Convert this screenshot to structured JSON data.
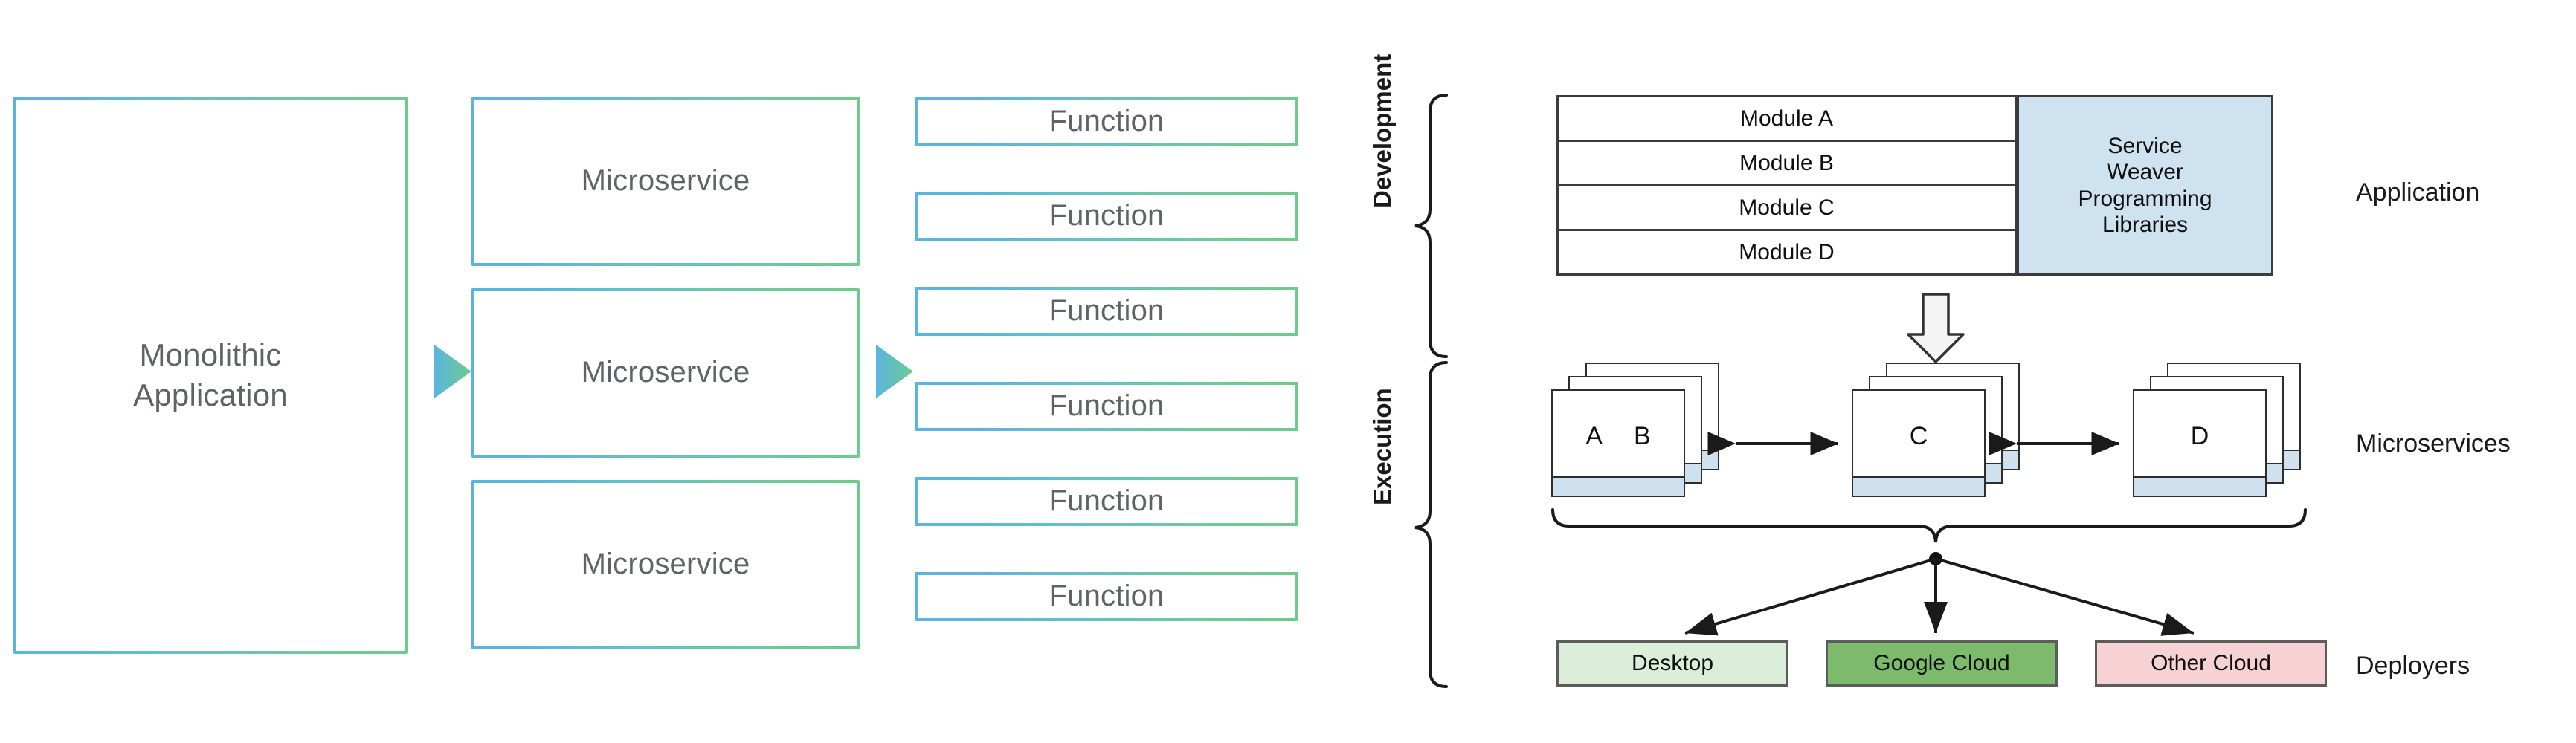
{
  "evolution": {
    "monolith": {
      "label": "Monolithic\nApplication",
      "line1": "Monolithic",
      "line2": "Application"
    },
    "arrow1_icon": "triangle-right-icon",
    "arrow2_icon": "triangle-right-icon",
    "microservices": [
      {
        "label": "Microservice"
      },
      {
        "label": "Microservice"
      },
      {
        "label": "Microservice"
      }
    ],
    "functions": [
      {
        "label": "Function"
      },
      {
        "label": "Function"
      },
      {
        "label": "Function"
      },
      {
        "label": "Function"
      },
      {
        "label": "Function"
      },
      {
        "label": "Function"
      }
    ],
    "colors": {
      "border_start": "#5bb4e0",
      "border_end": "#6ecb8c",
      "text": "#5f6368"
    }
  },
  "weaver": {
    "phases": [
      {
        "label": "Development"
      },
      {
        "label": "Execution"
      }
    ],
    "application": {
      "modules": [
        {
          "label": "Module A"
        },
        {
          "label": "Module B"
        },
        {
          "label": "Module C"
        },
        {
          "label": "Module D"
        }
      ],
      "libraries": {
        "label": "Service\nWeaver\nProgramming\nLibraries",
        "line1": "Service",
        "line2": "Weaver",
        "line3": "Programming",
        "line4": "Libraries",
        "fill": "#cfe2f0"
      }
    },
    "transform_arrow_icon": "block-arrow-down-icon",
    "microservices": [
      {
        "glyphs": [
          "A",
          "B"
        ],
        "g1": "A",
        "g2": "B"
      },
      {
        "glyphs": [
          "C"
        ],
        "g1": "C"
      },
      {
        "glyphs": [
          "D"
        ],
        "g1": "D"
      }
    ],
    "link_icons": [
      "double-arrow-horizontal-icon",
      "double-arrow-horizontal-icon"
    ],
    "deployers": [
      {
        "label": "Desktop",
        "fill": "#dbeeda",
        "border": "#5c5c5c"
      },
      {
        "label": "Google Cloud",
        "fill": "#7cbb6b",
        "border": "#5c5c5c"
      },
      {
        "label": "Other Cloud",
        "fill": "#f7d2d4",
        "border": "#5c5c5c"
      }
    ],
    "row_labels": [
      {
        "label": "Application"
      },
      {
        "label": "Microservices"
      },
      {
        "label": "Deployers"
      }
    ]
  }
}
